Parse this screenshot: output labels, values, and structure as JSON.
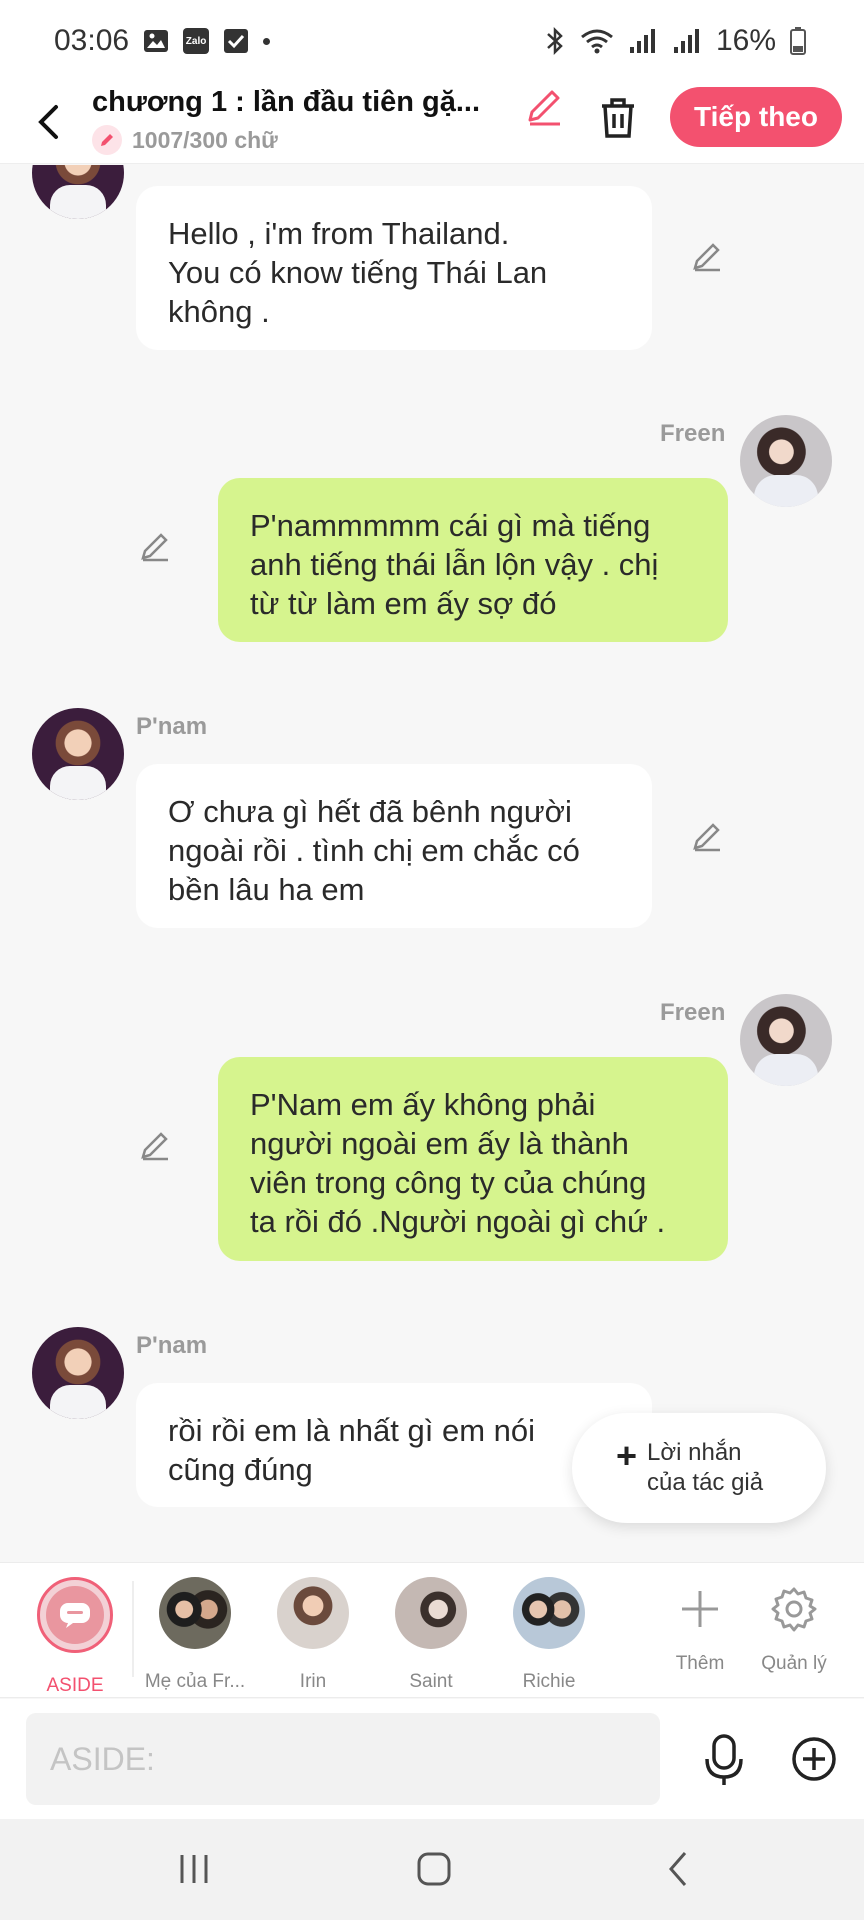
{
  "status_bar": {
    "time": "03:06",
    "zalo_label": "Zalo",
    "battery": "16%",
    "icons": [
      "image-icon",
      "zalo-icon",
      "check-icon",
      "bluetooth-icon",
      "wifi-icon",
      "signal-icon",
      "battery-icon"
    ]
  },
  "header": {
    "chapter_title": "chương 1 : lần đầu tiên gặ...",
    "word_count": "1007/300 chữ",
    "next_label": "Tiếp theo",
    "accent_color": "#f3516f"
  },
  "messages": [
    {
      "sender": "",
      "side": "left",
      "text_lines": [
        "Hello , i'm from Thailand.",
        "You có know tiếng Thái Lan",
        "không ."
      ]
    },
    {
      "sender": "Freen",
      "side": "right",
      "text_lines": [
        "P'nammmmm cái gì mà tiếng",
        "anh tiếng thái lẫn lộn vậy . chị",
        "từ từ làm em ấy sợ đó"
      ]
    },
    {
      "sender": "P'nam",
      "side": "left",
      "text_lines": [
        "Ơ chưa gì hết đã bênh người",
        "ngoài rồi . tình chị em chắc có",
        "bền lâu ha em"
      ]
    },
    {
      "sender": "Freen",
      "side": "right",
      "text_lines": [
        "P'Nam em ấy không phải",
        "người ngoài em ấy là thành",
        "viên trong công ty của chúng",
        "ta rồi đó .Người ngoài gì chứ ."
      ]
    },
    {
      "sender": "P'nam",
      "side": "left",
      "text_lines": [
        "rồi rồi em là nhất gì em nói",
        "cũng đúng"
      ]
    }
  ],
  "author_note": {
    "label_lines": [
      "Lời nhắn",
      "của tác giả"
    ]
  },
  "characters": [
    {
      "name": "ASIDE"
    },
    {
      "name": "Mẹ của Fr..."
    },
    {
      "name": "Irin"
    },
    {
      "name": "Saint"
    },
    {
      "name": "Richie"
    }
  ],
  "tools": {
    "add_label": "Thêm",
    "manage_label": "Quản lý"
  },
  "input": {
    "placeholder": "ASIDE:"
  },
  "colors": {
    "right_bubble": "#d6f48e",
    "left_bubble": "#ffffff",
    "background": "#f7f7f7"
  }
}
